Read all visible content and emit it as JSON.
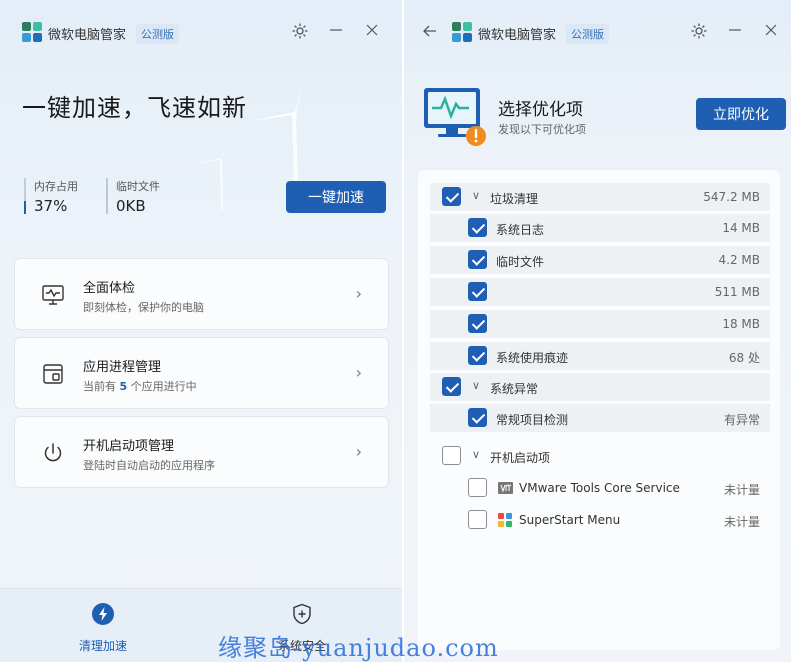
{
  "left_window": {
    "app_name": "微软电脑管家",
    "edition_badge": "公测版",
    "hero_title": "一键加速，飞速如新",
    "stats": {
      "memory_label": "内存占用",
      "memory_value": "37%",
      "temp_label": "临时文件",
      "temp_value": "0KB"
    },
    "accelerate_button": "一键加速",
    "cards": [
      {
        "title": "全面体检",
        "subtitle": "即刻体检，保护你的电脑"
      },
      {
        "title": "应用进程管理",
        "subtitle_prefix": "当前有",
        "subtitle_count": "5",
        "subtitle_suffix": "个应用进行中"
      },
      {
        "title": "开机启动项管理",
        "subtitle": "登陆时自动启动的应用程序"
      }
    ],
    "nav": [
      {
        "label": "清理加速",
        "icon": "lightning-icon",
        "active": true
      },
      {
        "label": "系统安全",
        "icon": "shield-plus-icon",
        "active": false
      }
    ]
  },
  "right_window": {
    "app_name": "微软电脑管家",
    "edition_badge": "公测版",
    "title": "选择优化项",
    "subtitle": "发现以下可优化项",
    "optimize_button": "立即优化",
    "sections": [
      {
        "label": "垃圾清理",
        "checked": true,
        "value": "547.2 MB",
        "items": [
          {
            "label": "系统日志",
            "checked": true,
            "value": "14 MB"
          },
          {
            "label": "临时文件",
            "checked": true,
            "value": "4.2 MB"
          },
          {
            "label": "",
            "checked": true,
            "value": "511 MB"
          },
          {
            "label": "",
            "checked": true,
            "value": "18 MB"
          },
          {
            "label": "系统使用痕迹",
            "checked": true,
            "value": "68 处"
          }
        ]
      },
      {
        "label": "系统异常",
        "checked": true,
        "value": "",
        "items": [
          {
            "label": "常规项目检测",
            "checked": true,
            "value": "有异常"
          }
        ]
      },
      {
        "label": "开机启动项",
        "checked": false,
        "value": "",
        "items": [
          {
            "label": "VMware Tools Core Service",
            "checked": false,
            "value": "未计量"
          },
          {
            "label": "SuperStart Menu",
            "checked": false,
            "value": "未计量"
          }
        ]
      }
    ]
  },
  "watermark": "缘聚岛-yuanjudao.com",
  "colors": {
    "accent": "#1f5fb3",
    "background": "#e9f0f7"
  }
}
